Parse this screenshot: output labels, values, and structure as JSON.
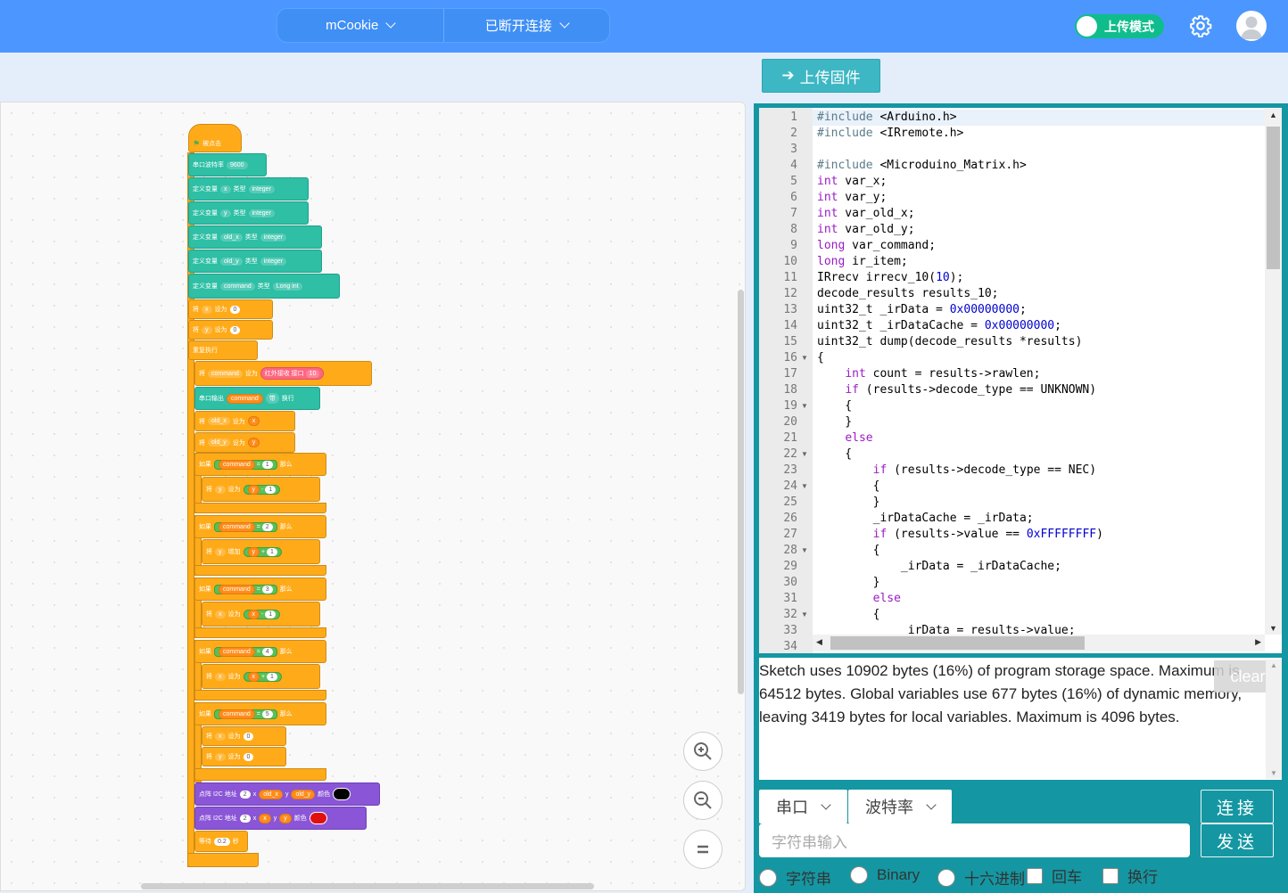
{
  "topbar": {
    "board_label": "mCookie",
    "connection_label": "已断开连接",
    "mode_toggle_label": "上传模式",
    "mode_on": true
  },
  "toolbar": {
    "upload_firmware_label": "上传固件"
  },
  "blocks": {
    "hat": "被点击",
    "serial_baud_label": "串口波特率",
    "serial_baud_value": "9600",
    "declare_label": "定义变量",
    "type_label": "类型",
    "vars": [
      {
        "name": "x",
        "type": "integer"
      },
      {
        "name": "y",
        "type": "integer"
      },
      {
        "name": "old_x",
        "type": "integer"
      },
      {
        "name": "old_y",
        "type": "integer"
      },
      {
        "name": "command",
        "type": "Long int"
      }
    ],
    "set_label": "将",
    "set_to_label": "设为",
    "increase_label": "增加",
    "zero": "0",
    "forever_label": "重复执行",
    "ir_label": "红外接收 接口",
    "ir_pin": "10",
    "serial_print_label": "串口输出",
    "serial_with_label": "带",
    "newline_label": "换行",
    "if_label": "如果",
    "then_label": "那么",
    "command_var": "command",
    "eq": "=",
    "conds": [
      "1",
      "2",
      "3",
      "4",
      "5"
    ],
    "one": "1",
    "matrix_label": "点阵 I2C 地址",
    "matrix_addr": "2",
    "color_label": "颜色",
    "wait_label": "等待",
    "wait_value": "0.2",
    "seconds_label": "秒"
  },
  "editor": {
    "line_numbers": [
      "1",
      "2",
      "3",
      "4",
      "5",
      "6",
      "7",
      "8",
      "9",
      "10",
      "11",
      "12",
      "13",
      "14",
      "15",
      "16",
      "17",
      "18",
      "19",
      "20",
      "21",
      "22",
      "23",
      "24",
      "25",
      "26",
      "27",
      "28",
      "29",
      "30",
      "31",
      "32",
      "33",
      "34"
    ],
    "lines": [
      "#include <Arduino.h>",
      "#include <IRremote.h>",
      "",
      "#include <Microduino_Matrix.h>",
      "int var_x;",
      "int var_y;",
      "int var_old_x;",
      "int var_old_y;",
      "long var_command;",
      "long ir_item;",
      "IRrecv irrecv_10(10);",
      "decode_results results_10;",
      "uint32_t _irData = 0x00000000;",
      "uint32_t _irDataCache = 0x00000000;",
      "uint32_t dump(decode_results *results)",
      "{",
      "    int count = results->rawlen;",
      "    if (results->decode_type == UNKNOWN)",
      "    {",
      "    }",
      "    else",
      "    {",
      "        if (results->decode_type == NEC)",
      "        {",
      "        }",
      "        _irDataCache = _irData;",
      "        if (results->value == 0xFFFFFFFF)",
      "        {",
      "            _irData = _irDataCache;",
      "        }",
      "        else",
      "        {",
      "            _irData = results->value;",
      ""
    ]
  },
  "console": {
    "output": "Sketch uses 10902 bytes (16%) of program storage space. Maximum is 64512 bytes. Global variables use 677 bytes (16%) of dynamic memory, leaving 3419 bytes for local variables. Maximum is 4096 bytes.",
    "clear_label": "clear"
  },
  "serial": {
    "port_label": "串口",
    "baud_label": "波特率",
    "connect_label": "连接",
    "send_label": "发送",
    "input_placeholder": "字符串输入",
    "radio_string": "字符串",
    "radio_binary": "Binary",
    "radio_hex": "十六进制",
    "check_cr": "回车",
    "check_lf": "换行"
  },
  "colors": {
    "topbar": "#4c97ff",
    "panel": "#1497a2",
    "block_yellow": "#ffab19",
    "block_teal": "#2ebfa5",
    "block_purple": "#8a55d7",
    "toggle_on": "#0fbd8c"
  }
}
